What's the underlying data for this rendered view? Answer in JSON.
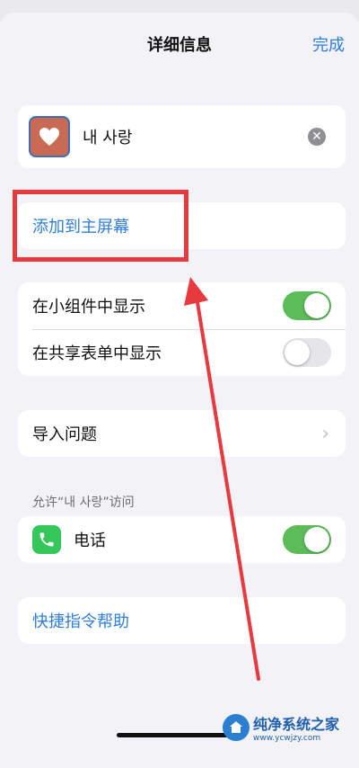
{
  "header": {
    "title": "详细信息",
    "done_label": "完成"
  },
  "shortcut": {
    "name": "내 사랑",
    "icon": "heart-icon",
    "icon_color": "#c96a55"
  },
  "add_home": {
    "label": "添加到主屏幕"
  },
  "toggles": [
    {
      "label": "在小组件中显示",
      "on": true
    },
    {
      "label": "在共享表单中显示",
      "on": false
    }
  ],
  "import": {
    "label": "导入问题"
  },
  "permission": {
    "section_label": "允许“내 사랑”访问",
    "item_label": "电话",
    "icon": "phone-icon",
    "on": true
  },
  "help": {
    "label": "快捷指令帮助"
  },
  "watermark": {
    "title": "纯净系统之家",
    "url": "www.ycwjzy.com"
  },
  "colors": {
    "accent": "#2f7ed8",
    "toggle_on": "#5cbc5a",
    "annotation": "#e63a3f"
  }
}
